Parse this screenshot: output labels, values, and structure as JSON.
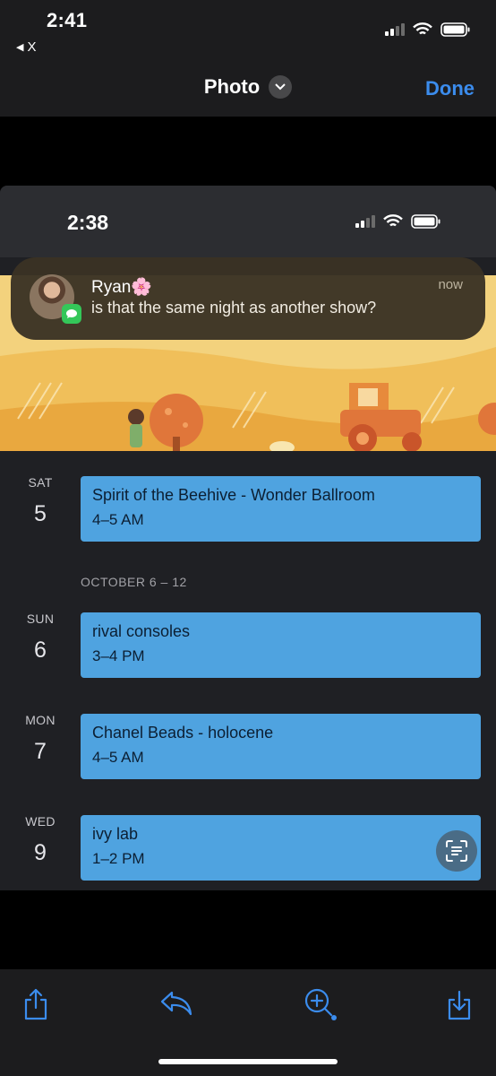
{
  "outer_status": {
    "time": "2:41",
    "back_label": "X"
  },
  "nav": {
    "title": "Photo",
    "done_label": "Done"
  },
  "inner_status": {
    "time": "2:38"
  },
  "notification": {
    "sender": "Ryan🌸",
    "message": "is that the same night as another show?",
    "time": "now"
  },
  "agenda": {
    "days": [
      {
        "weekday": "SAT",
        "day": "5",
        "event_title": "Spirit of the Beehive - Wonder Ballroom",
        "event_time": "4–5 AM"
      },
      {
        "weekday": "SUN",
        "day": "6",
        "event_title": "rival consoles",
        "event_time": "3–4 PM"
      },
      {
        "weekday": "MON",
        "day": "7",
        "event_title": "Chanel Beads - holocene",
        "event_time": "4–5 AM"
      },
      {
        "weekday": "WED",
        "day": "9",
        "event_title": "ivy lab",
        "event_time": "1–2 PM"
      }
    ],
    "week_header": "OCTOBER 6 – 12"
  },
  "icons": {
    "share": "share-icon",
    "reply": "reply-icon",
    "zoom": "zoom-in-icon",
    "save": "download-icon",
    "live_text": "live-text-icon"
  },
  "colors": {
    "accent": "#3b8ced",
    "event": "#4fa3e0",
    "messages": "#34c759"
  }
}
